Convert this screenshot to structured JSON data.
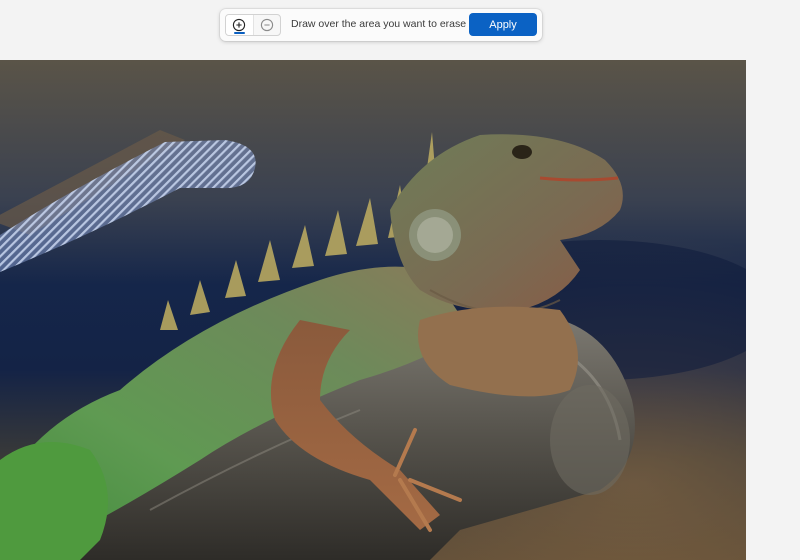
{
  "toolbar": {
    "hint_text": "Draw over the area you want to erase",
    "apply_label": "Apply",
    "add_mode_icon": "plus-circle-icon",
    "remove_mode_icon": "minus-circle-icon",
    "active_mode": "add"
  },
  "canvas": {
    "subject": "iguana-on-branch-photo",
    "selection_stroke": "diagonal-hatch"
  },
  "colors": {
    "accent": "#0b62c4",
    "background": "#f3f3f3"
  }
}
